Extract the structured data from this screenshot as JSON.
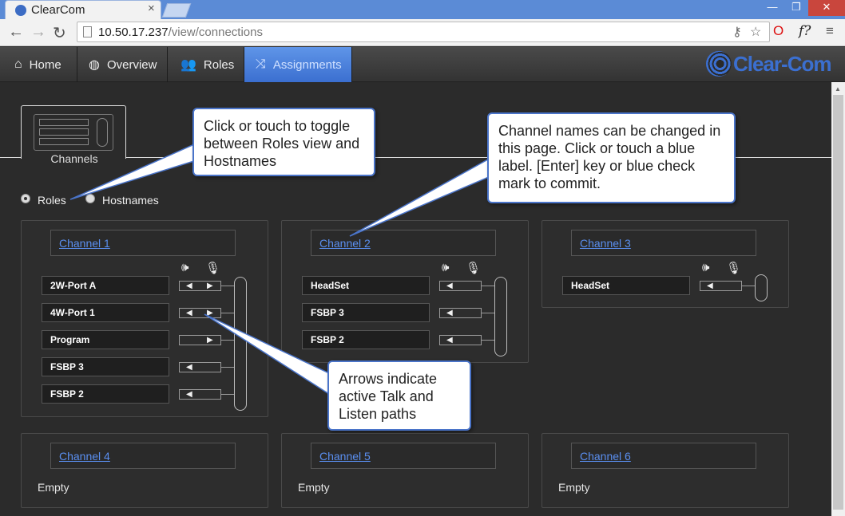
{
  "browser": {
    "tab_title": "ClearCom",
    "tab_close": "×",
    "url_host": "10.50.17.237",
    "url_path": "/view/connections",
    "window_buttons": [
      "—",
      "❐",
      "✕"
    ]
  },
  "nav": {
    "items": [
      {
        "label": "Home",
        "icon": "home-icon"
      },
      {
        "label": "Overview",
        "icon": "globe-icon"
      },
      {
        "label": "Roles",
        "icon": "users-icon"
      },
      {
        "label": "Assignments",
        "icon": "assignments-icon",
        "active": true
      }
    ],
    "brand": "Clear-Com"
  },
  "view_tabs": {
    "channels_label": "Channels"
  },
  "view_mode": {
    "options": [
      "Roles",
      "Hostnames"
    ],
    "selected": "Roles"
  },
  "channels": [
    {
      "name": "Channel 1",
      "ports": [
        {
          "label": "2W-Port A",
          "talk": true,
          "listen": true
        },
        {
          "label": "4W-Port 1",
          "talk": true,
          "listen": true
        },
        {
          "label": "Program",
          "talk": false,
          "listen": true
        },
        {
          "label": "FSBP 3",
          "talk": true,
          "listen": false
        },
        {
          "label": "FSBP 2",
          "talk": true,
          "listen": false
        }
      ]
    },
    {
      "name": "Channel 2",
      "ports": [
        {
          "label": "HeadSet",
          "talk": true,
          "listen": false
        },
        {
          "label": "FSBP 3",
          "talk": true,
          "listen": false
        },
        {
          "label": "FSBP 2",
          "talk": true,
          "listen": false
        }
      ]
    },
    {
      "name": "Channel 3",
      "ports": [
        {
          "label": "HeadSet",
          "talk": true,
          "listen": false
        }
      ]
    },
    {
      "name": "Channel 4",
      "empty": "Empty"
    },
    {
      "name": "Channel 5",
      "empty": "Empty"
    },
    {
      "name": "Channel 6",
      "empty": "Empty"
    }
  ],
  "callouts": {
    "toggle": "Click or touch to toggle between Roles view and Hostnames",
    "names": "Channel names can be changed in this page. Click or touch a blue label. [Enter] key or blue check mark to commit.",
    "arrows": "Arrows indicate active Talk and Listen paths"
  },
  "colors": {
    "accent": "#3b6fd0",
    "link": "#5a8ff0",
    "background": "#2b2b2b"
  }
}
